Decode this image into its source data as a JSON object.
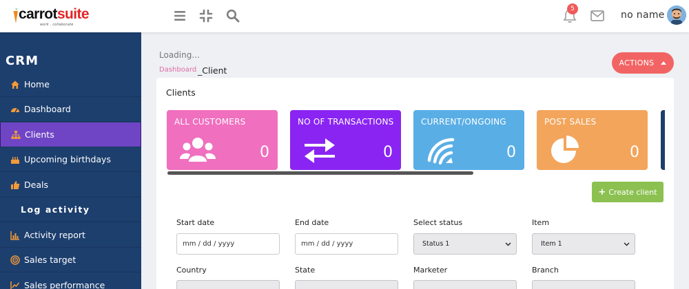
{
  "header": {
    "logo_word_a": "carrot",
    "logo_word_b": "suite",
    "logo_tagline": "work . collaborate",
    "notification_count": "5",
    "username": "no name",
    "icons": [
      "menu-icon",
      "compress-icon",
      "search-icon",
      "bell-icon",
      "mail-icon"
    ]
  },
  "sidebar": {
    "title": "CRM",
    "items": [
      {
        "label": "Home",
        "icon": "home-icon"
      },
      {
        "label": "Dashboard",
        "icon": "gauge-icon"
      },
      {
        "label": "Clients",
        "icon": "sitemap-icon",
        "active": true
      },
      {
        "label": "Upcoming birthdays",
        "icon": "cake-icon"
      },
      {
        "label": "Deals",
        "icon": "thumbs-up-icon"
      },
      {
        "label": "Log activity",
        "icon": ""
      },
      {
        "label": "Activity report",
        "icon": "chart-icon"
      },
      {
        "label": "Sales target",
        "icon": "target-icon"
      },
      {
        "label": "Sales performance",
        "icon": "line-chart-icon"
      }
    ]
  },
  "page": {
    "loading": "Loading...",
    "breadcrumb_link": "Dashboard",
    "breadcrumb_current": "_Client",
    "actions_label": "ACTIONS"
  },
  "clients_card": {
    "title": "Clients",
    "stats": [
      {
        "label": "ALL CUSTOMERS",
        "value": "0",
        "color": "#f06fbf",
        "icon": "users-icon"
      },
      {
        "label": "NO OF TRANSACTIONS",
        "value": "0",
        "color": "#8a24f2",
        "icon": "exchange-icon"
      },
      {
        "label": "CURRENT/ONGOING",
        "value": "0",
        "color": "#5aaee6",
        "icon": "signal-icon"
      },
      {
        "label": "POST SALES",
        "value": "0",
        "color": "#f3a55c",
        "icon": "pie-icon"
      }
    ],
    "create_label": "Create client",
    "filters": {
      "start_date_label": "Start date",
      "start_date_placeholder": "mm / dd / yyyy",
      "end_date_label": "End date",
      "end_date_placeholder": "mm / dd / yyyy",
      "status_label": "Select status",
      "status_value": "Status 1",
      "item_label": "Item",
      "item_value": "Item 1",
      "country_label": "Country",
      "state_label": "State",
      "marketer_label": "Marketer",
      "branch_label": "Branch"
    }
  }
}
